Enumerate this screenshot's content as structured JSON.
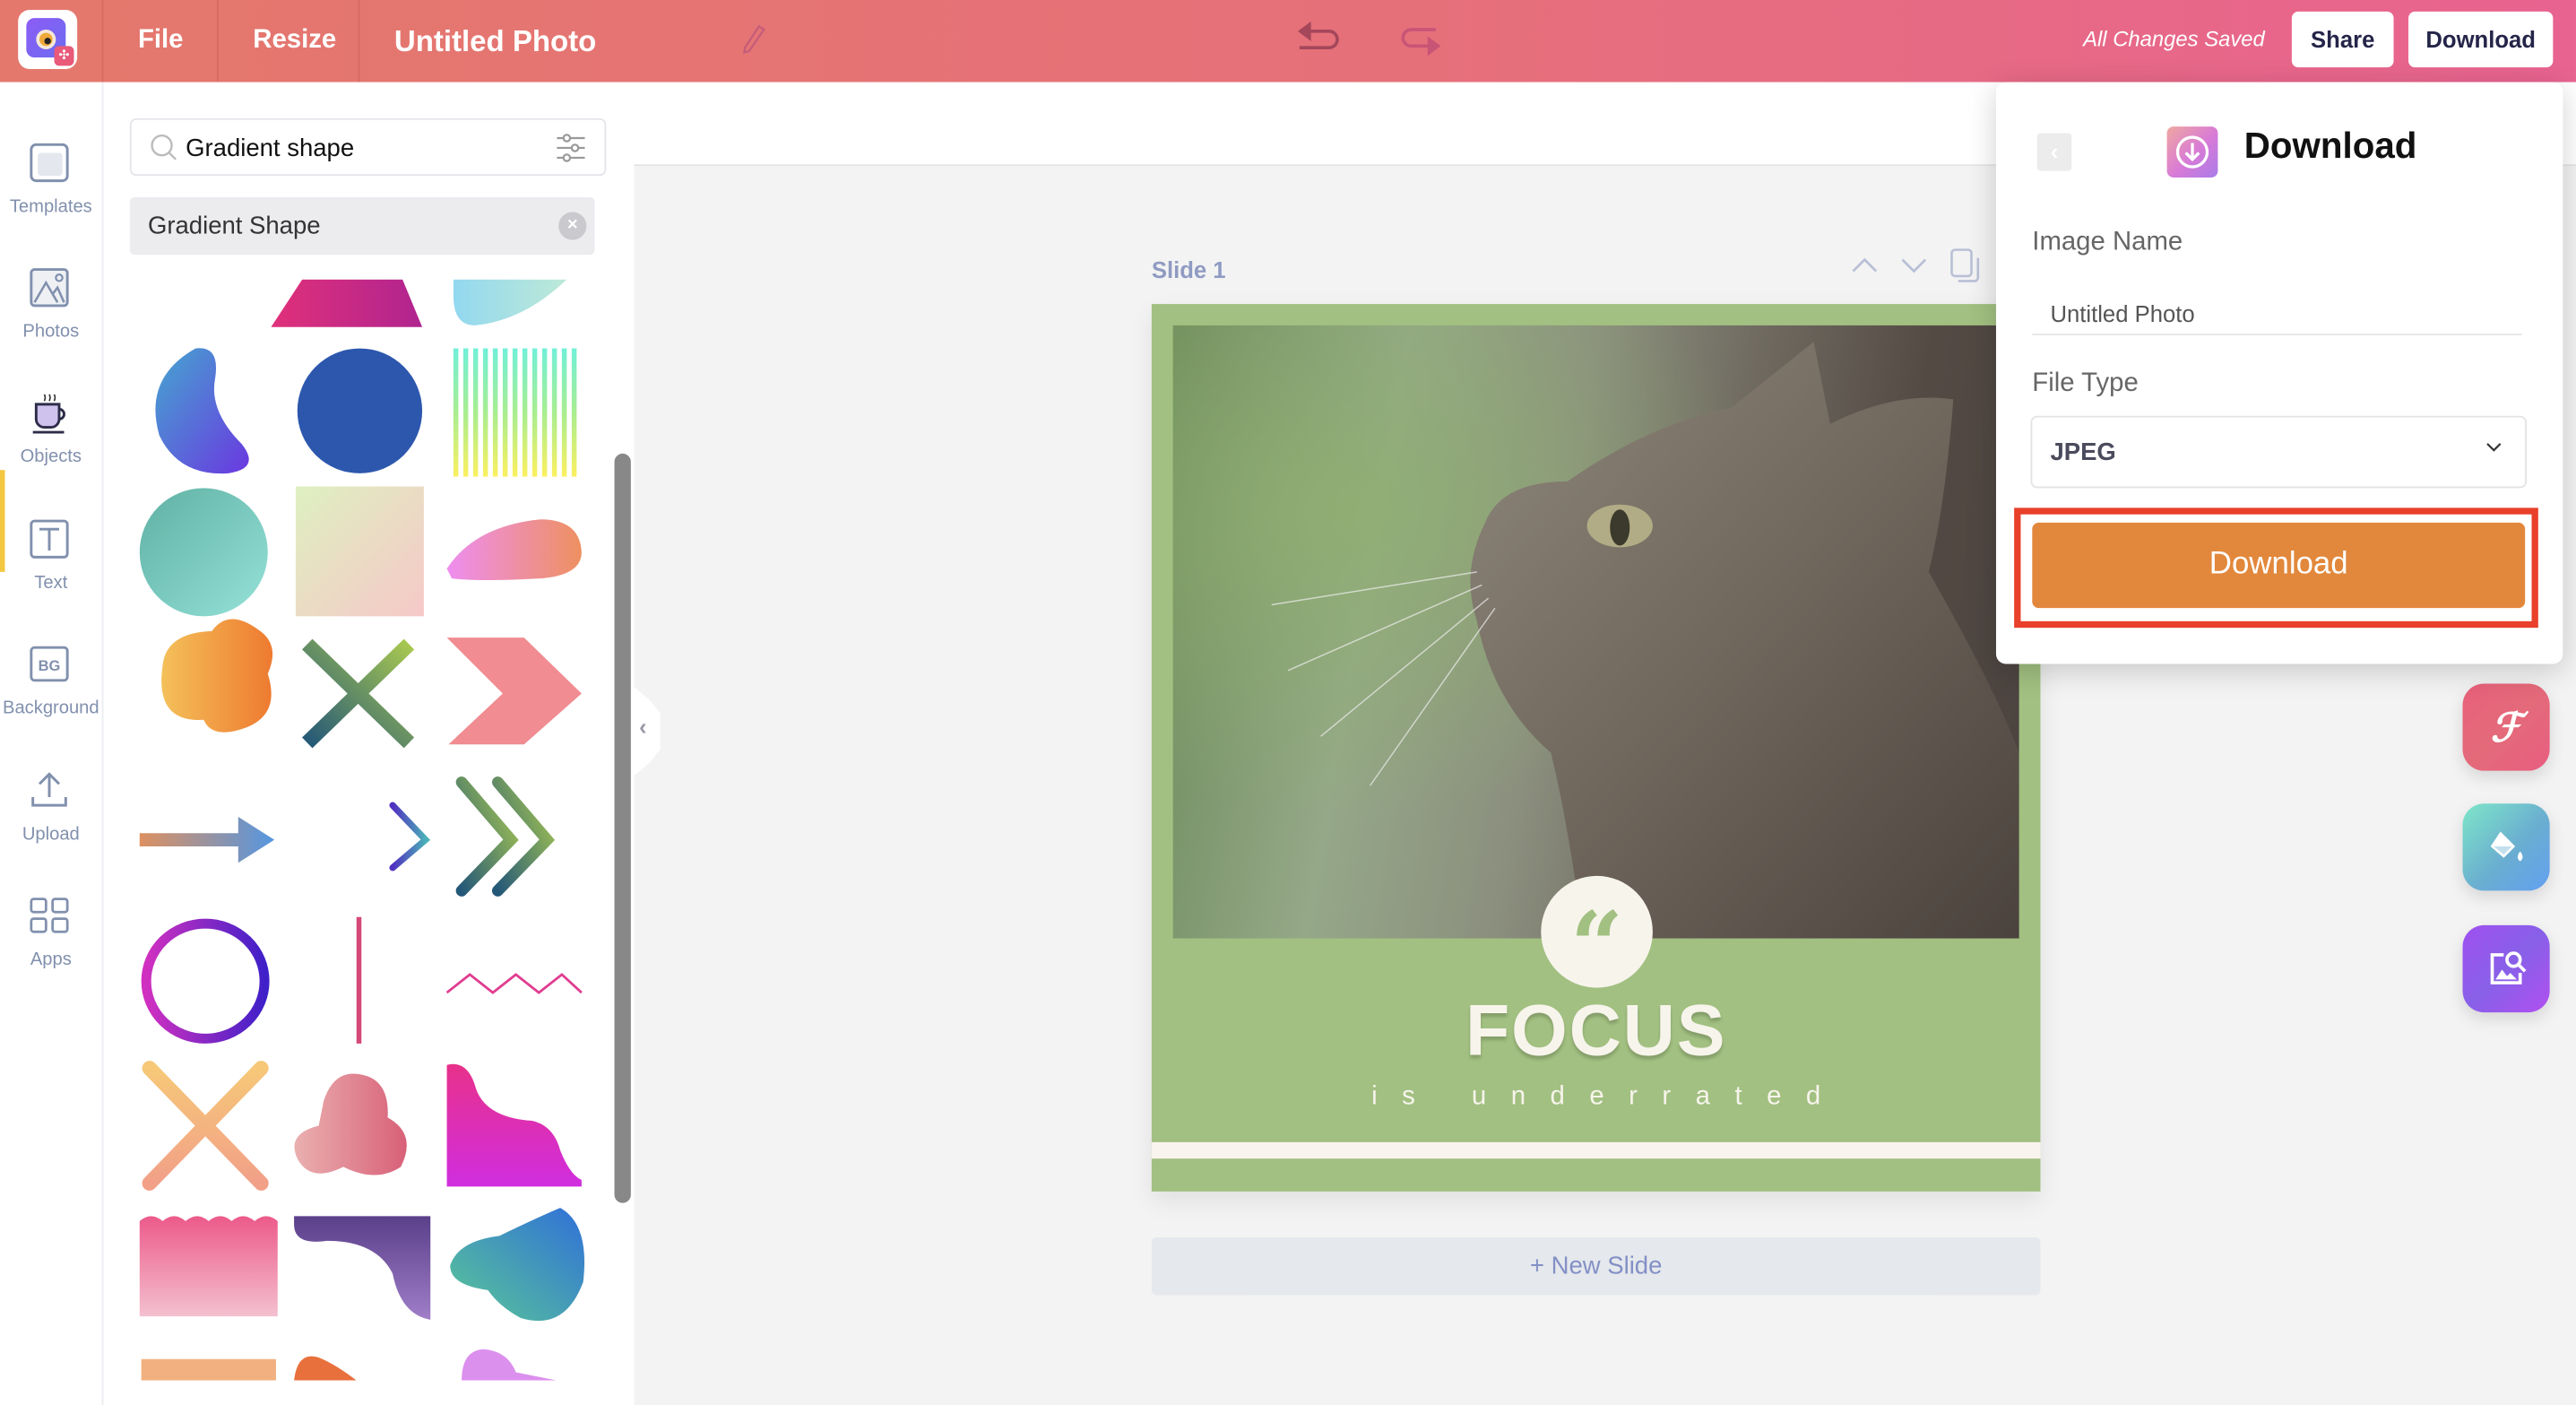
{
  "topbar": {
    "file_label": "File",
    "resize_label": "Resize",
    "doc_title": "Untitled Photo",
    "status": "All Changes Saved",
    "share_label": "Share",
    "download_label": "Download",
    "gradient_colors": [
      "#e4786c",
      "#e86390"
    ]
  },
  "rail": {
    "items": [
      {
        "label": "Templates",
        "icon": "templates-icon"
      },
      {
        "label": "Photos",
        "icon": "photos-icon"
      },
      {
        "label": "Objects",
        "icon": "objects-icon",
        "active": true
      },
      {
        "label": "Text",
        "icon": "text-icon"
      },
      {
        "label": "Background",
        "icon": "background-icon",
        "glyph": "BG"
      },
      {
        "label": "Upload",
        "icon": "upload-icon"
      },
      {
        "label": "Apps",
        "icon": "apps-icon"
      }
    ]
  },
  "panel": {
    "search_value": "Gradient shape",
    "search_placeholder": "Search",
    "chip_label": "Gradient Shape",
    "chip_close": "×"
  },
  "canvas": {
    "slide_label": "Slide 1",
    "quote_glyph": "“",
    "headline": "FOCUS",
    "subline": "is underrated",
    "new_slide_label": "+ New Slide",
    "slide_bg_color": "#a2c081"
  },
  "fabs": [
    {
      "name": "font-tool",
      "glyph": "ℱ"
    },
    {
      "name": "fill-tool",
      "glyph": "fill"
    },
    {
      "name": "image-search-tool",
      "glyph": "img"
    }
  ],
  "download_panel": {
    "title": "Download",
    "image_name_label": "Image Name",
    "image_name_value": "Untitled Photo",
    "file_type_label": "File Type",
    "file_type_value": "JPEG",
    "download_button_label": "Download",
    "button_color": "#e2883c",
    "highlight_color": "#e8402a"
  }
}
